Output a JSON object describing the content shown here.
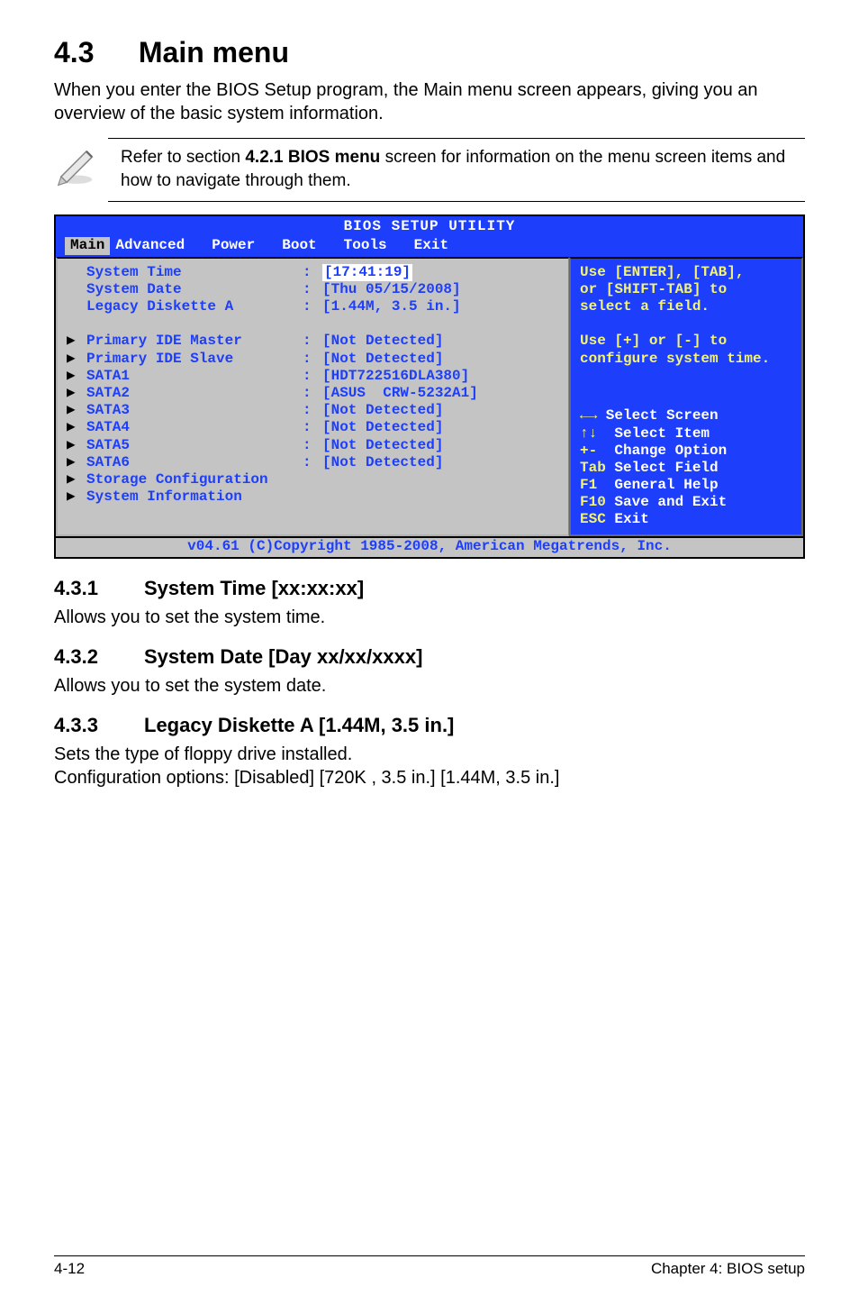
{
  "heading": {
    "number": "4.3",
    "title": "Main menu"
  },
  "intro": "When you enter the BIOS Setup program, the Main menu screen appears, giving you an overview of the basic system information.",
  "note": {
    "pre": "Refer to section ",
    "bold": "4.2.1 BIOS menu",
    "post": " screen for information on the menu screen items and how to navigate through them."
  },
  "bios": {
    "title": "BIOS SETUP UTILITY",
    "tabs": [
      "Main",
      "Advanced",
      "Power",
      "Boot",
      "Tools",
      "Exit"
    ],
    "left_top": [
      {
        "arrow": "",
        "label": "System Time",
        "value": "[17:41:19]",
        "highlight": true
      },
      {
        "arrow": "",
        "label": "System Date",
        "value": "[Thu 05/15/2008]"
      },
      {
        "arrow": "",
        "label": "Legacy Diskette A",
        "value": "[1.44M, 3.5 in.]"
      }
    ],
    "left_mid": [
      {
        "arrow": "▶",
        "label": "Primary IDE Master",
        "value": "[Not Detected]"
      },
      {
        "arrow": "▶",
        "label": "Primary IDE Slave",
        "value": "[Not Detected]"
      },
      {
        "arrow": "▶",
        "label": "SATA1",
        "value": "[HDT722516DLA380]"
      },
      {
        "arrow": "▶",
        "label": "SATA2",
        "value": "[ASUS  CRW-5232A1]"
      },
      {
        "arrow": "▶",
        "label": "SATA3",
        "value": "[Not Detected]"
      },
      {
        "arrow": "▶",
        "label": "SATA4",
        "value": "[Not Detected]"
      },
      {
        "arrow": "▶",
        "label": "SATA5",
        "value": "[Not Detected]"
      },
      {
        "arrow": "▶",
        "label": "SATA6",
        "value": "[Not Detected]"
      }
    ],
    "left_bot": [
      {
        "arrow": "▶",
        "label": "Storage Configuration"
      },
      {
        "arrow": "",
        "label": ""
      },
      {
        "arrow": "▶",
        "label": "System Information"
      }
    ],
    "help_top": "Use [ENTER], [TAB],\nor [SHIFT-TAB] to\nselect a field.\n\nUse [+] or [-] to\nconfigure system time.",
    "help_bottom_lines": [
      {
        "sym": "←→",
        "text": " Select Screen"
      },
      {
        "sym": "↑↓",
        "text": "  Select Item"
      },
      {
        "sym": "+-",
        "text": "  Change Option"
      },
      {
        "sym": "Tab",
        "text": " Select Field"
      },
      {
        "sym": "F1",
        "text": "  General Help"
      },
      {
        "sym": "F10",
        "text": " Save and Exit"
      },
      {
        "sym": "ESC",
        "text": " Exit"
      }
    ],
    "footer": "v04.61 (C)Copyright 1985-2008, American Megatrends, Inc."
  },
  "sections": [
    {
      "num": "4.3.1",
      "title": "System Time [xx:xx:xx]",
      "body": "Allows you to set the system time."
    },
    {
      "num": "4.3.2",
      "title": "System Date [Day xx/xx/xxxx]",
      "body": "Allows you to set the system date."
    },
    {
      "num": "4.3.3",
      "title": "Legacy Diskette A [1.44M, 3.5 in.]",
      "body": "Sets the type of floppy drive installed.\nConfiguration options: [Disabled] [720K , 3.5 in.] [1.44M, 3.5 in.]"
    }
  ],
  "footer": {
    "left": "4-12",
    "right": "Chapter 4: BIOS setup"
  }
}
